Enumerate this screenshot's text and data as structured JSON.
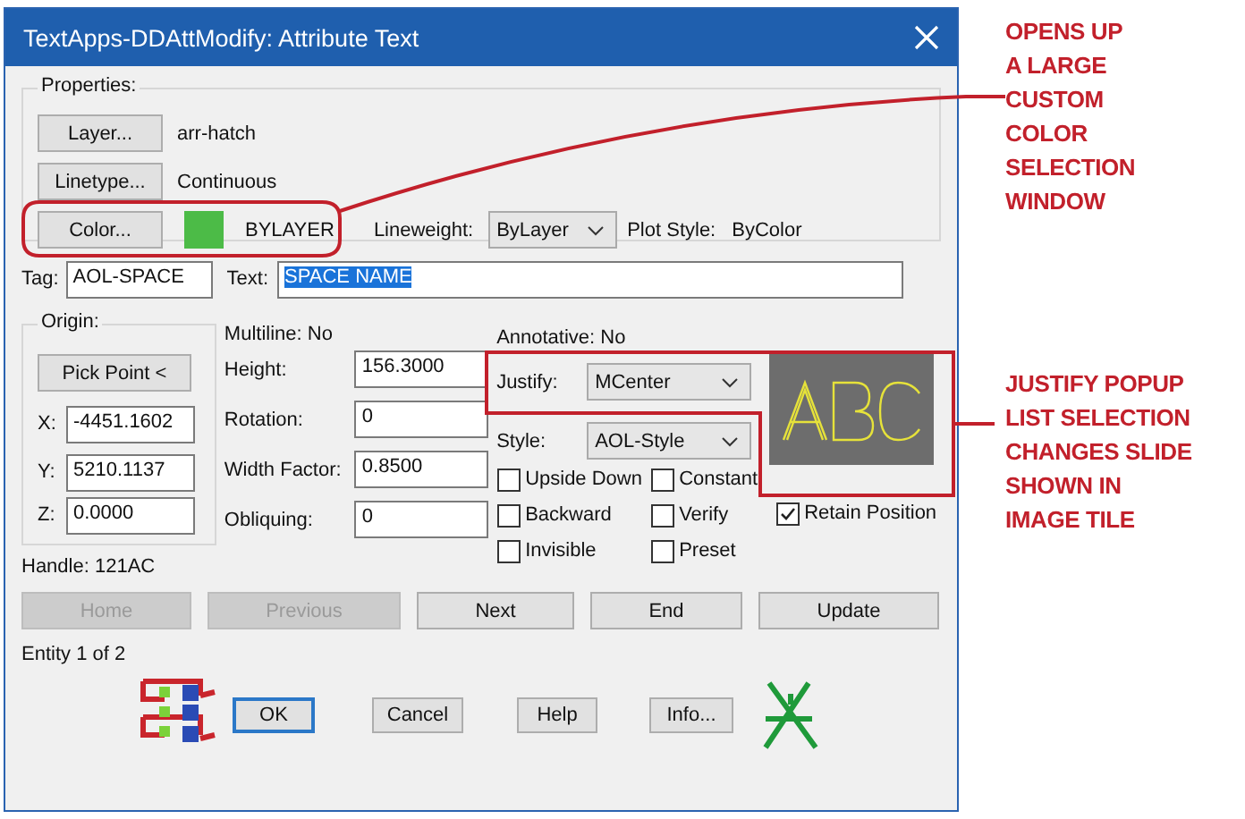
{
  "window": {
    "title": "TextApps-DDAttModify: Attribute Text"
  },
  "properties": {
    "label": "Properties:",
    "rows": [
      {
        "button": "Layer...",
        "value": "arr-hatch"
      },
      {
        "button": "Linetype...",
        "value": "Continuous"
      }
    ],
    "color": {
      "button": "Color...",
      "value": "BYLAYER"
    },
    "lineweight": {
      "label": "Lineweight:",
      "value": "ByLayer"
    },
    "plot_style": {
      "label": "Plot Style:",
      "value": "ByColor"
    }
  },
  "tag": {
    "label": "Tag:",
    "value": "AOL-SPACE"
  },
  "text": {
    "label": "Text:",
    "value": "SPACE NAME",
    "selected": true
  },
  "origin": {
    "label": "Origin:",
    "button": "Pick Point <",
    "fields": [
      {
        "label": "X:",
        "value": "-4451.1602"
      },
      {
        "label": "Y:",
        "value": "5210.1137"
      },
      {
        "label": "Z:",
        "value": "0.0000"
      }
    ]
  },
  "multiline": "Multiline: No",
  "metrics": [
    {
      "label": "Height:",
      "value": "156.3000"
    },
    {
      "label": "Rotation:",
      "value": "0"
    },
    {
      "label": "Width Factor:",
      "value": "0.8500"
    },
    {
      "label": "Obliquing:",
      "value": "0"
    }
  ],
  "annotative": "Annotative: No",
  "justify": {
    "label": "Justify:",
    "value": "MCenter"
  },
  "style": {
    "label": "Style:",
    "value": "AOL-Style"
  },
  "options": [
    {
      "label": "Upside Down",
      "checked": false
    },
    {
      "label": "Constant",
      "checked": false
    },
    {
      "label": "Backward",
      "checked": false
    },
    {
      "label": "Verify",
      "checked": false
    },
    {
      "label": "Invisible",
      "checked": false
    },
    {
      "label": "Preset",
      "checked": false
    }
  ],
  "retain_position": {
    "label": "Retain Position",
    "checked": true
  },
  "handle": "Handle: 121AC",
  "nav_buttons": [
    {
      "label": "Home",
      "disabled": true
    },
    {
      "label": "Previous",
      "disabled": true
    },
    {
      "label": "Next",
      "disabled": false
    },
    {
      "label": "End",
      "disabled": false
    },
    {
      "label": "Update",
      "disabled": false
    }
  ],
  "entity": "Entity 1 of 2",
  "buttons": [
    {
      "label": "OK",
      "default": true
    },
    {
      "label": "Cancel",
      "default": false
    },
    {
      "label": "Help",
      "default": false
    },
    {
      "label": "Info...",
      "default": false
    }
  ],
  "annotations": [
    {
      "lines": [
        "OPENS UP",
        "A LARGE",
        "CUSTOM",
        "COLOR",
        "SELECTION",
        "WINDOW"
      ]
    },
    {
      "lines": [
        "JUSTIFY POPUP",
        "LIST SELECTION",
        "CHANGES SLIDE",
        "SHOWN IN",
        "IMAGE TILE"
      ]
    }
  ]
}
